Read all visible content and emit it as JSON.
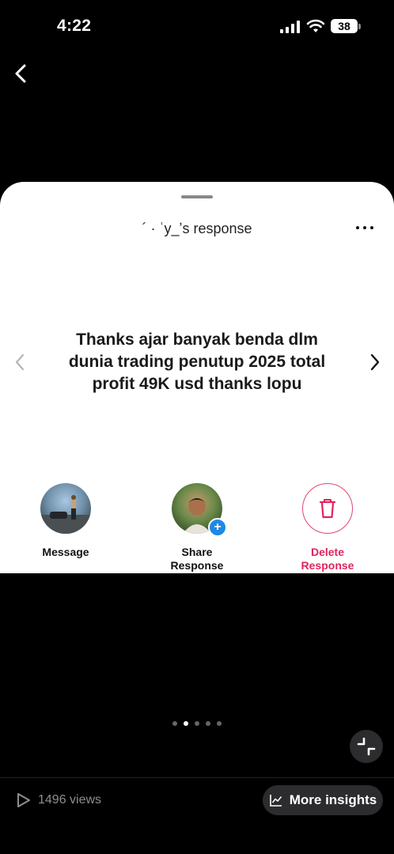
{
  "status_bar": {
    "time": "4:22",
    "battery": "38"
  },
  "sheet": {
    "title": "´ · ʿy_ʼs response",
    "response_text": "Thanks ajar banyak benda dlm dunia trading penutup 2025 total profit 49K usd thanks lopu"
  },
  "actions": [
    {
      "label_1": "Message",
      "label_2": ""
    },
    {
      "label_1": "Share",
      "label_2": "Response"
    },
    {
      "label_1": "Delete",
      "label_2": "Response"
    }
  ],
  "pager": {
    "count": 5,
    "active_index": 1
  },
  "footer": {
    "views": "1496 views",
    "insights_label": "More insights"
  },
  "colors": {
    "accent_delete": "#e0245e",
    "plus_badge": "#1e88e5"
  }
}
